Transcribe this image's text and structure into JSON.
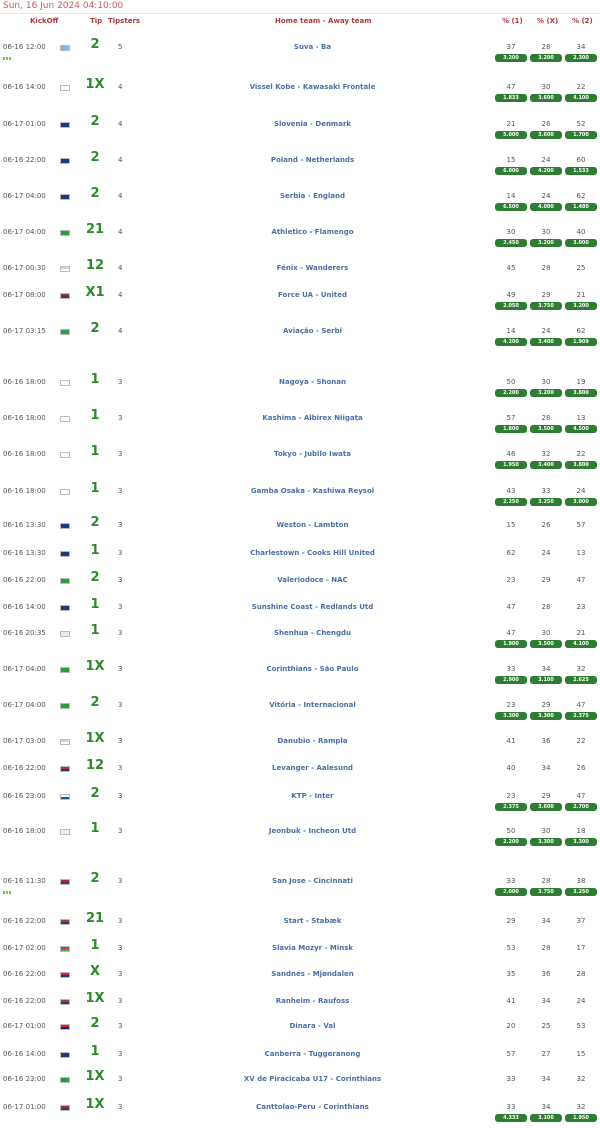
{
  "page": {
    "datetime": "Sun, 16 Jun 2024 04:10:00",
    "headers": {
      "kickoff": "KickOff",
      "tip": "Tip",
      "tipsters": "Tipsters",
      "match": "Home team - Away team",
      "p1": "% (1)",
      "px": "% (X)",
      "p2": "% (2)"
    }
  },
  "colors": {
    "tip": "#2c8a2c",
    "odds_badge": "#2e7d32",
    "match_link": "#4a6fa5",
    "header": "#b03a3a"
  },
  "rows": [
    {
      "kickoff": "06-16 12:00",
      "flag": "fiji-flag",
      "flag_colors": [
        "#7ab6e6",
        "#7ab6e6"
      ],
      "tip": "2",
      "tipsters": "5",
      "match": "Suva - Ba",
      "p1": "37",
      "px": "28",
      "p2": "34",
      "o1": "3.200",
      "ox": "3.200",
      "o2": "2.300",
      "live": true
    },
    {
      "kickoff": "06-16 14:00",
      "flag": "japan-flag",
      "flag_colors": [
        "#ffffff",
        "#ffffff"
      ],
      "tip": "1X",
      "tipsters": "4",
      "match": "Vissel Kobe - Kawasaki Frontale",
      "p1": "47",
      "px": "30",
      "p2": "22",
      "o1": "1.833",
      "ox": "3.600",
      "o2": "4.100"
    },
    {
      "kickoff": "06-17 01:00",
      "flag": "europe-flag",
      "flag_colors": [
        "#1f3a78",
        "#1f3a78"
      ],
      "tip": "2",
      "tipsters": "4",
      "match": "Slovenia - Denmark",
      "p1": "21",
      "px": "26",
      "p2": "52",
      "o1": "5.000",
      "ox": "3.600",
      "o2": "1.700"
    },
    {
      "kickoff": "06-16 22:00",
      "flag": "europe-flag",
      "flag_colors": [
        "#1f3a78",
        "#1f3a78"
      ],
      "tip": "2",
      "tipsters": "4",
      "match": "Poland - Netherlands",
      "p1": "15",
      "px": "24",
      "p2": "60",
      "o1": "6.000",
      "ox": "4.200",
      "o2": "1.533"
    },
    {
      "kickoff": "06-17 04:00",
      "flag": "europe-flag",
      "flag_colors": [
        "#1f3a78",
        "#1f3a78"
      ],
      "tip": "2",
      "tipsters": "4",
      "match": "Serbia - England",
      "p1": "14",
      "px": "24",
      "p2": "62",
      "o1": "6.500",
      "ox": "4.000",
      "o2": "1.480"
    },
    {
      "kickoff": "06-17 04:00",
      "flag": "brazil-flag",
      "flag_colors": [
        "#2a9d3a",
        "#2a9d3a"
      ],
      "tip": "21",
      "tipsters": "4",
      "match": "Athletico - Flamengo",
      "p1": "30",
      "px": "30",
      "p2": "40",
      "o1": "2.450",
      "ox": "3.200",
      "o2": "3.000"
    },
    {
      "kickoff": "06-17 00:30",
      "flag": "uruguay-flag",
      "flag_colors": [
        "#c9d7ea",
        "#ffffff"
      ],
      "tip": "12",
      "tipsters": "4",
      "match": "Fénix - Wanderers",
      "p1": "45",
      "px": "28",
      "p2": "25"
    },
    {
      "kickoff": "06-17 08:00",
      "flag": "usa-flag",
      "flag_colors": [
        "#b22234",
        "#3c3b6e"
      ],
      "tip": "X1",
      "tipsters": "4",
      "match": "Force UA - United",
      "p1": "49",
      "px": "29",
      "p2": "21",
      "o1": "2.050",
      "ox": "3.750",
      "o2": "3.200"
    },
    {
      "kickoff": "06-17 03:15",
      "flag": "brazil-flag",
      "flag_colors": [
        "#2a9d3a",
        "#2a9d3a"
      ],
      "tip": "2",
      "tipsters": "4",
      "match": "Aviação - Serbi",
      "p1": "14",
      "px": "24",
      "p2": "62",
      "o1": "4.200",
      "ox": "3.400",
      "o2": "1.909"
    },
    {
      "kickoff": "06-16 18:00",
      "flag": "japan-flag",
      "flag_colors": [
        "#ffffff",
        "#ffffff"
      ],
      "tip": "1",
      "tipsters": "3",
      "match": "Nagoya - Shonan",
      "p1": "50",
      "px": "30",
      "p2": "19",
      "o1": "2.200",
      "ox": "3.200",
      "o2": "3.800"
    },
    {
      "kickoff": "06-16 18:00",
      "flag": "japan-flag",
      "flag_colors": [
        "#ffffff",
        "#ffffff"
      ],
      "tip": "1",
      "tipsters": "3",
      "match": "Kashima - Albirex Niigata",
      "p1": "57",
      "px": "28",
      "p2": "13",
      "o1": "1.800",
      "ox": "3.500",
      "o2": "4.500"
    },
    {
      "kickoff": "06-16 18:00",
      "flag": "japan-flag",
      "flag_colors": [
        "#ffffff",
        "#ffffff"
      ],
      "tip": "1",
      "tipsters": "3",
      "match": "Tokyo - Jubilo Iwata",
      "p1": "46",
      "px": "32",
      "p2": "22",
      "o1": "1.950",
      "ox": "3.400",
      "o2": "3.800"
    },
    {
      "kickoff": "06-16 18:00",
      "flag": "japan-flag",
      "flag_colors": [
        "#ffffff",
        "#ffffff"
      ],
      "tip": "1",
      "tipsters": "3",
      "match": "Gamba Osaka - Kashiwa Reysol",
      "p1": "43",
      "px": "33",
      "p2": "24",
      "o1": "2.250",
      "ox": "3.250",
      "o2": "3.000"
    },
    {
      "kickoff": "06-16 13:30",
      "flag": "australia-flag",
      "flag_colors": [
        "#1f3a78",
        "#1f3a78"
      ],
      "tip": "2",
      "tipsters": "3",
      "match": "Weston - Lambton",
      "p1": "15",
      "px": "26",
      "p2": "57"
    },
    {
      "kickoff": "06-16 13:30",
      "flag": "australia-flag",
      "flag_colors": [
        "#1f3a78",
        "#1f3a78"
      ],
      "tip": "1",
      "tipsters": "3",
      "match": "Charlestown - Cooks Hill United",
      "p1": "62",
      "px": "24",
      "p2": "13"
    },
    {
      "kickoff": "06-16 22:00",
      "flag": "brazil-flag",
      "flag_colors": [
        "#2a9d3a",
        "#2a9d3a"
      ],
      "tip": "2",
      "tipsters": "3",
      "match": "Valeriodoce - NAC",
      "p1": "23",
      "px": "29",
      "p2": "47"
    },
    {
      "kickoff": "06-16 14:00",
      "flag": "australia-flag",
      "flag_colors": [
        "#1f3a78",
        "#1f3a78"
      ],
      "tip": "1",
      "tipsters": "3",
      "match": "Sunshine Coast - Redlands Utd",
      "p1": "47",
      "px": "28",
      "p2": "23"
    },
    {
      "kickoff": "06-16 20:35",
      "flag": "china-flag",
      "flag_colors": [
        "#e8e8e8",
        "#e8e8e8"
      ],
      "tip": "1",
      "tipsters": "3",
      "match": "Shenhua - Chengdu",
      "p1": "47",
      "px": "30",
      "p2": "21",
      "o1": "1.900",
      "ox": "3.500",
      "o2": "4.100"
    },
    {
      "kickoff": "06-17 04:00",
      "flag": "brazil-flag",
      "flag_colors": [
        "#2a9d3a",
        "#2a9d3a"
      ],
      "tip": "1X",
      "tipsters": "3",
      "match": "Corinthians - São Paulo",
      "p1": "33",
      "px": "34",
      "p2": "32",
      "o1": "2.900",
      "ox": "3.100",
      "o2": "2.625"
    },
    {
      "kickoff": "06-17 04:00",
      "flag": "brazil-flag",
      "flag_colors": [
        "#2a9d3a",
        "#2a9d3a"
      ],
      "tip": "2",
      "tipsters": "3",
      "match": "Vitória - Internacional",
      "p1": "23",
      "px": "29",
      "p2": "47",
      "o1": "3.300",
      "ox": "3.300",
      "o2": "2.375"
    },
    {
      "kickoff": "06-17 03:00",
      "flag": "uruguay-flag",
      "flag_colors": [
        "#c9d7ea",
        "#ffffff"
      ],
      "tip": "1X",
      "tipsters": "3",
      "match": "Danubio - Rampla",
      "p1": "41",
      "px": "36",
      "p2": "22"
    },
    {
      "kickoff": "06-16 22:00",
      "flag": "norway-flag",
      "flag_colors": [
        "#ba2d3c",
        "#1f3a78"
      ],
      "tip": "12",
      "tipsters": "3",
      "match": "Levanger - Aalesund",
      "p1": "40",
      "px": "34",
      "p2": "26"
    },
    {
      "kickoff": "06-16 23:00",
      "flag": "finland-flag",
      "flag_colors": [
        "#ffffff",
        "#1f4fa0"
      ],
      "tip": "2",
      "tipsters": "3",
      "match": "KTP - Inter",
      "p1": "23",
      "px": "29",
      "p2": "47",
      "o1": "2.375",
      "ox": "3.600",
      "o2": "2.700"
    },
    {
      "kickoff": "06-16 18:00",
      "flag": "korea-flag",
      "flag_colors": [
        "#eeeeee",
        "#eeeeee"
      ],
      "tip": "1",
      "tipsters": "3",
      "match": "Jeonbuk - Incheon Utd",
      "p1": "50",
      "px": "30",
      "p2": "18",
      "o1": "2.200",
      "ox": "3.300",
      "o2": "3.300"
    },
    {
      "kickoff": "06-16 11:30",
      "flag": "usa-flag",
      "flag_colors": [
        "#b22234",
        "#3c3b6e"
      ],
      "tip": "2",
      "tipsters": "3",
      "match": "San Jose - Cincinnati",
      "p1": "33",
      "px": "28",
      "p2": "38",
      "o1": "2.000",
      "ox": "3.750",
      "o2": "3.250",
      "live": true
    },
    {
      "kickoff": "06-16 22:00",
      "flag": "norway-flag",
      "flag_colors": [
        "#ba2d3c",
        "#1f3a78"
      ],
      "tip": "21",
      "tipsters": "3",
      "match": "Start - Stabæk",
      "p1": "29",
      "px": "34",
      "p2": "37"
    },
    {
      "kickoff": "06-17 02:00",
      "flag": "belarus-flag",
      "flag_colors": [
        "#c8313e",
        "#4aa657"
      ],
      "tip": "1",
      "tipsters": "3",
      "match": "Slavia Mozyr - Minsk",
      "p1": "53",
      "px": "28",
      "p2": "17"
    },
    {
      "kickoff": "06-16 22:00",
      "flag": "norway-flag",
      "flag_colors": [
        "#ba2d3c",
        "#1f3a78"
      ],
      "tip": "X",
      "tipsters": "3",
      "match": "Sandnes - Mjøndalen",
      "p1": "35",
      "px": "36",
      "p2": "28"
    },
    {
      "kickoff": "06-16 22:00",
      "flag": "norway-flag",
      "flag_colors": [
        "#ba2d3c",
        "#1f3a78"
      ],
      "tip": "1X",
      "tipsters": "3",
      "match": "Ranheim - Raufoss",
      "p1": "41",
      "px": "34",
      "p2": "24"
    },
    {
      "kickoff": "06-17 01:00",
      "flag": "croatia-flag",
      "flag_colors": [
        "#d52b1e",
        "#171796"
      ],
      "tip": "2",
      "tipsters": "3",
      "match": "Dinara - Val",
      "p1": "20",
      "px": "25",
      "p2": "53"
    },
    {
      "kickoff": "06-16 14:00",
      "flag": "australia-flag",
      "flag_colors": [
        "#1f3a78",
        "#1f3a78"
      ],
      "tip": "1",
      "tipsters": "3",
      "match": "Canberra - Tuggeranong",
      "p1": "57",
      "px": "27",
      "p2": "15"
    },
    {
      "kickoff": "06-16 23:00",
      "flag": "brazil-flag",
      "flag_colors": [
        "#2a9d3a",
        "#2a9d3a"
      ],
      "tip": "1X",
      "tipsters": "3",
      "match": "XV de Piracicaba U17 - Corinthians",
      "p1": "33",
      "px": "34",
      "p2": "32"
    },
    {
      "kickoff": "06-17 01:00",
      "flag": "usa-flag",
      "flag_colors": [
        "#b22234",
        "#3c3b6e"
      ],
      "tip": "1X",
      "tipsters": "3",
      "match": "Canttolao-Peru - Corinthians",
      "p1": "33",
      "px": "34",
      "p2": "32",
      "o1": "4.333",
      "ox": "3.100",
      "o2": "1.950"
    }
  ]
}
